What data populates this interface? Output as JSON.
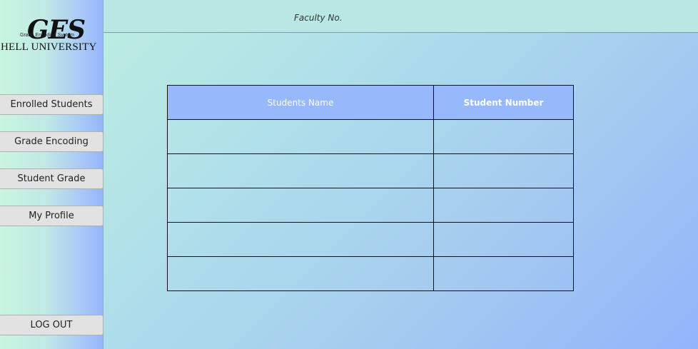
{
  "sidebar": {
    "logo": {
      "mark": "GES",
      "tagline": "Grade Encoding System",
      "university": "HELL UNIVERSITY"
    },
    "nav": [
      {
        "label": "Enrolled Students"
      },
      {
        "label": "Grade Encoding"
      },
      {
        "label": "Student Grade"
      },
      {
        "label": "My Profile"
      }
    ],
    "logout_label": "LOG OUT"
  },
  "header": {
    "faculty_label": "Faculty No."
  },
  "table": {
    "columns": [
      "Students Name",
      "Student Number"
    ],
    "rows": [
      [
        "",
        ""
      ],
      [
        "",
        ""
      ],
      [
        "",
        ""
      ],
      [
        "",
        ""
      ],
      [
        "",
        ""
      ]
    ]
  },
  "colors": {
    "header_fill": "#97b8fb",
    "header_text": "#ffffff",
    "button_fill": "#e2e2e2",
    "topbar_fill": "#b8e7e4"
  }
}
